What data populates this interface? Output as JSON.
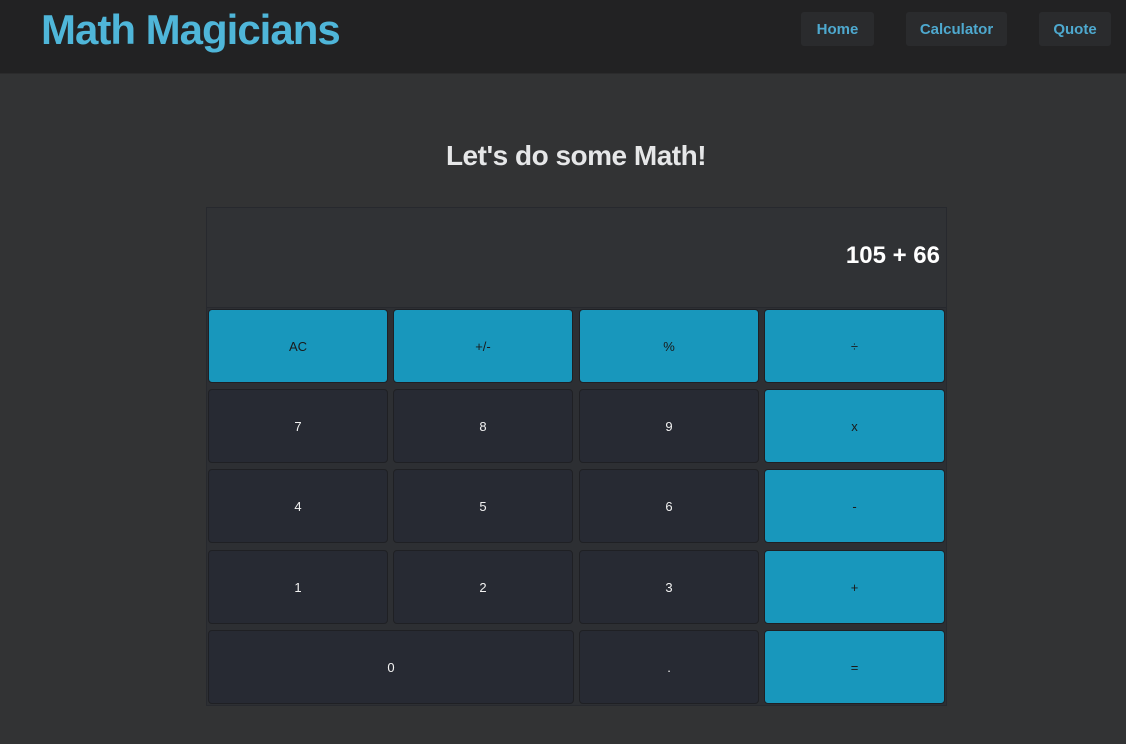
{
  "navbar": {
    "brand": "Math Magicians",
    "links": [
      "Home",
      "Calculator",
      "Quote"
    ]
  },
  "heading": "Let's do some Math!",
  "display": {
    "value": "105 + 66"
  },
  "keys": {
    "ac": "AC",
    "sign": "+/-",
    "percent": "%",
    "divide": "÷",
    "seven": "7",
    "eight": "8",
    "nine": "9",
    "multiply": "x",
    "four": "4",
    "five": "5",
    "six": "6",
    "minus": "-",
    "one": "1",
    "two": "2",
    "three": "3",
    "plus": "+",
    "zero": "0",
    "dot": ".",
    "equals": "="
  },
  "colors": {
    "brand": "#4fb6d9",
    "operator": "#1897bc",
    "digit": "#272a33",
    "background": "#323334",
    "navbar": "#222223"
  }
}
